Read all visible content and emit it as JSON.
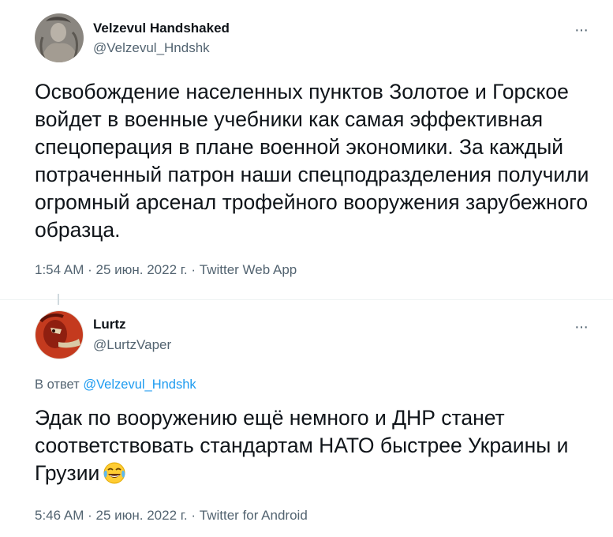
{
  "tweets": [
    {
      "author_name": "Velzevul Handshaked",
      "author_handle": "@Velzevul_Hndshk",
      "more_label": "···",
      "text": "Освобождение населенных пунктов Золотое и Горское войдет в военные учебники как самая эффективная спецоперация в плане военной экономики. За каждый потраченный патрон наши спецподразделения получили огромный арсенал трофейного вооружения зарубежного образца.",
      "time": "1:54 AM",
      "separator": "·",
      "date": "25 июн. 2022 г.",
      "source": "Twitter Web App"
    },
    {
      "author_name": "Lurtz",
      "author_handle": "@LurtzVaper",
      "more_label": "···",
      "reply_prefix": "В ответ",
      "reply_to": "@Velzevul_Hndshk",
      "text": "Эдак по вооружению ещё немного и ДНР станет соответствовать стандартам НАТО быстрее Украины и Грузии",
      "emoji": "face-with-tears-of-joy-emoji",
      "time": "5:46 AM",
      "separator": "·",
      "date": "25 июн. 2022 г.",
      "source": "Twitter for Android"
    }
  ],
  "colors": {
    "text": "#0f1419",
    "secondary": "#536471",
    "link": "#1d9bf0",
    "divider": "#eff3f4"
  }
}
